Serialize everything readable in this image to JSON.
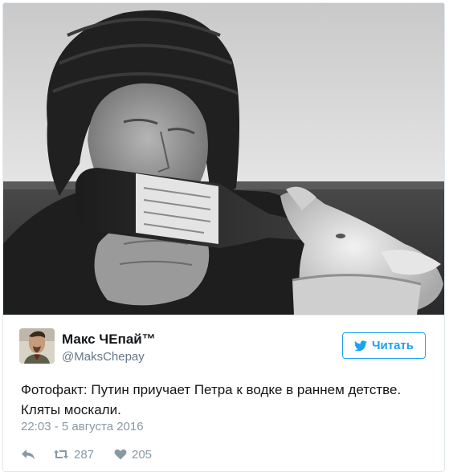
{
  "tweet": {
    "author_name": "Макс ЧЕпай™",
    "author_handle": "@MaksChepay",
    "follow_label": "Читать",
    "text": "Фотофакт: Путин приучает Петра к водке в раннем детстве. Кляты москали.",
    "timestamp": "22:03 - 5 августа 2016",
    "retweet_count": "287",
    "like_count": "205"
  },
  "icons": {
    "follow": "twitter-bird-icon",
    "reply": "reply-icon",
    "retweet": "retweet-icon",
    "like": "heart-icon"
  },
  "colors": {
    "accent": "#1da1f2",
    "text": "#14171a",
    "muted": "#657786",
    "meta": "#8899a6",
    "border": "#e1e8ed"
  }
}
